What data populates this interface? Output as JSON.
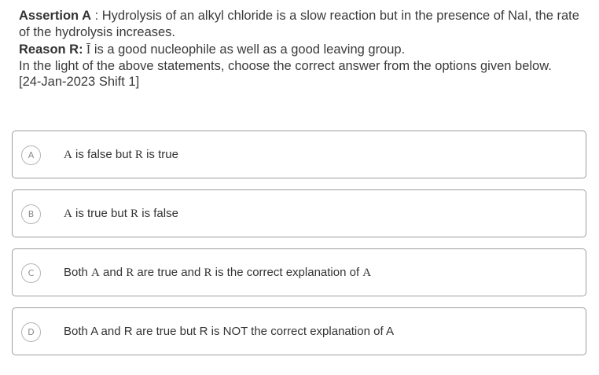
{
  "question": {
    "assertion_label": "Assertion A",
    "assertion_sep": " : ",
    "assertion_text": "Hydrolysis of an alkyl chloride is a slow reaction but in the presence of NaI, the rate of the hydrolysis increases.",
    "reason_label": "Reason R:",
    "reason_ion": " Ī",
    "reason_text": " is a good nucleophile as well as a good leaving group.",
    "instruction": "In the light of the above statements, choose the correct answer from the options given below.",
    "exam_ref": "[24-Jan-2023 Shift 1]"
  },
  "options": [
    {
      "letter": "A",
      "parts": [
        "",
        "A",
        " is false but ",
        "R",
        " is true"
      ]
    },
    {
      "letter": "B",
      "parts": [
        "",
        "A",
        " is true but ",
        "R",
        " is false"
      ]
    },
    {
      "letter": "C",
      "parts": [
        "Both ",
        "A",
        " and ",
        "R",
        " are true and ",
        "R",
        " is the correct explanation of ",
        "A",
        ""
      ]
    },
    {
      "letter": "D",
      "text": "Both A and R are true but R is NOT the correct explanation of A"
    }
  ]
}
